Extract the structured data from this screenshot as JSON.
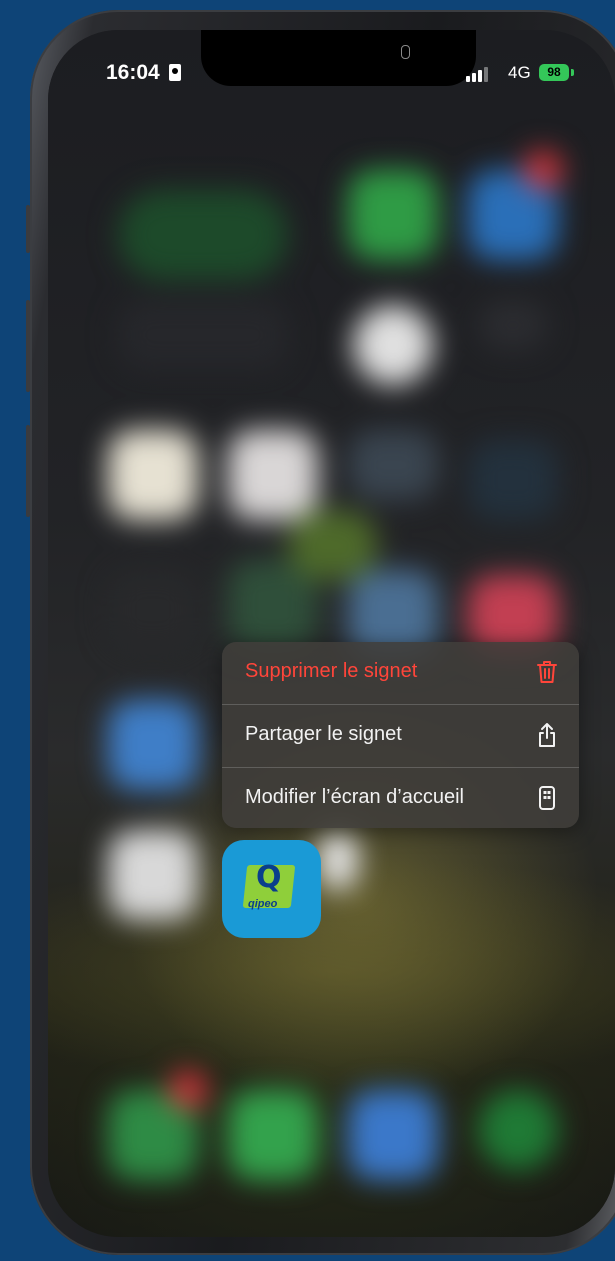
{
  "status_bar": {
    "time": "16:04",
    "network": "4G",
    "battery": "98"
  },
  "context_menu": {
    "items": [
      {
        "label": "Supprimer le signet",
        "icon": "trash-icon",
        "color": "#ff453a"
      },
      {
        "label": "Partager le signet",
        "icon": "share-icon"
      },
      {
        "label": "Modifier l’écran d’accueil",
        "icon": "phone-screen-icon"
      }
    ]
  },
  "app": {
    "name": "Qipeo",
    "logo_letter": "Q",
    "logo_text": "qipeo",
    "background": "#1a9ad6"
  },
  "colors": {
    "background": "#0e4477",
    "destructive": "#ff453a",
    "battery": "#34c759"
  }
}
